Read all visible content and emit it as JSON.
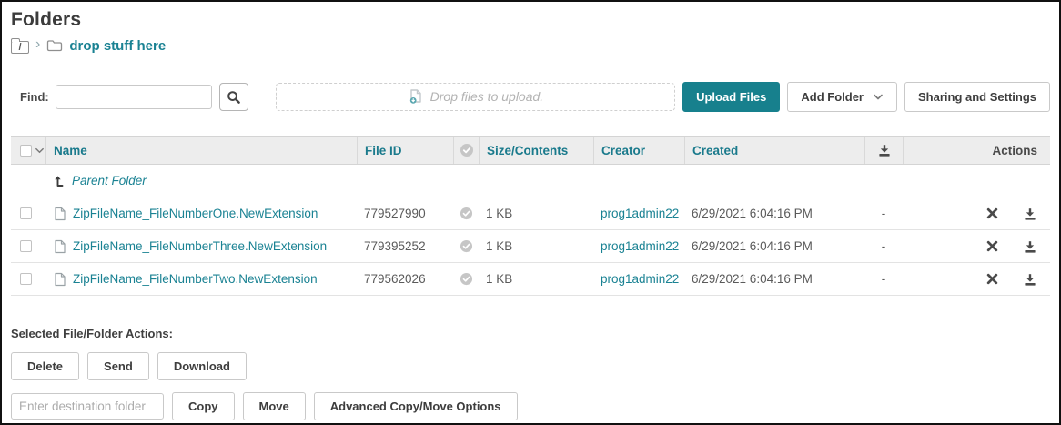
{
  "title": "Folders",
  "breadcrumb": {
    "root_label": "/",
    "separator": "›",
    "current": "drop stuff here"
  },
  "toolbar": {
    "find_label": "Find:",
    "find_value": "",
    "dropzone_text": "Drop files to upload.",
    "upload_label": "Upload Files",
    "add_folder_label": "Add Folder",
    "sharing_label": "Sharing and Settings"
  },
  "table": {
    "headers": {
      "name": "Name",
      "file_id": "File ID",
      "size": "Size/Contents",
      "creator": "Creator",
      "created": "Created",
      "actions": "Actions"
    },
    "parent_label": "Parent Folder",
    "rows": [
      {
        "name": "ZipFileName_FileNumberOne.NewExtension",
        "file_id": "779527990",
        "size": "1 KB",
        "creator": "prog1admin22",
        "created": "6/29/2021 6:04:16 PM",
        "download_status": "-"
      },
      {
        "name": "ZipFileName_FileNumberThree.NewExtension",
        "file_id": "779395252",
        "size": "1 KB",
        "creator": "prog1admin22",
        "created": "6/29/2021 6:04:16 PM",
        "download_status": "-"
      },
      {
        "name": "ZipFileName_FileNumberTwo.NewExtension",
        "file_id": "779562026",
        "size": "1 KB",
        "creator": "prog1admin22",
        "created": "6/29/2021 6:04:16 PM",
        "download_status": "-"
      }
    ]
  },
  "actions_panel": {
    "label": "Selected File/Folder Actions:",
    "delete_label": "Delete",
    "send_label": "Send",
    "download_label": "Download",
    "destination_placeholder": "Enter destination folder",
    "copy_label": "Copy",
    "move_label": "Move",
    "advanced_label": "Advanced Copy/Move Options"
  },
  "icons": {
    "search": "magnifier",
    "breadcrumb_root": "root-folder-with-slash",
    "folder": "folder-outline",
    "file": "page-outline",
    "scan_ok": "check-in-circle",
    "row_delete": "bold-x",
    "row_download": "arrow-into-tray",
    "parent_up": "up-arrow-from-corner",
    "chevron_down": "v"
  },
  "colors": {
    "accent_teal": "#17808d",
    "link_teal": "#1a8293",
    "header_text_teal": "#1a7a8c",
    "header_bg": "#ededed",
    "muted_gray": "#6e6e79",
    "icon_gray": "#4a4a4a"
  }
}
